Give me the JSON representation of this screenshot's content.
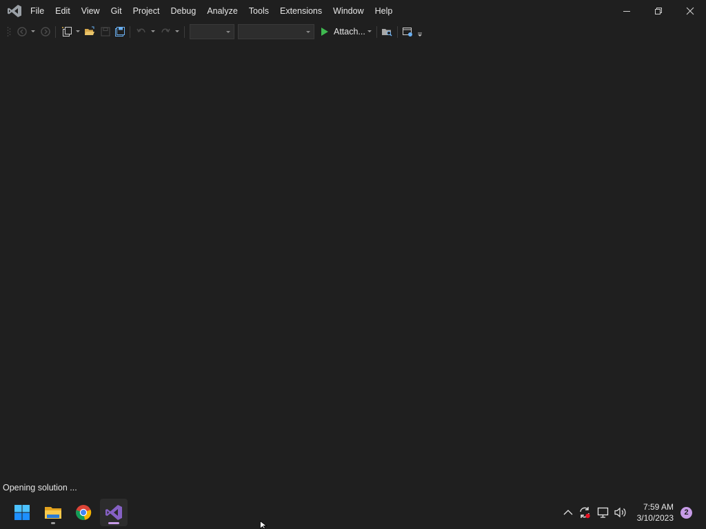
{
  "menu": {
    "items": [
      "File",
      "Edit",
      "View",
      "Git",
      "Project",
      "Debug",
      "Analyze",
      "Tools",
      "Extensions",
      "Window",
      "Help"
    ]
  },
  "window_controls": {
    "minimize_icon": "minimize-icon",
    "restore_icon": "restore-icon",
    "close_icon": "close-icon"
  },
  "toolbar": {
    "attach_label": "Attach...",
    "solution_config_value": "",
    "solution_platform_value": ""
  },
  "status": {
    "text": "Opening solution ..."
  },
  "taskbar": {
    "apps": [
      "start-icon",
      "file-explorer-icon",
      "chrome-icon",
      "visual-studio-icon"
    ],
    "clock_time": "7:59 AM",
    "clock_date": "3/10/2023",
    "notification_count": "2"
  },
  "colors": {
    "background": "#1f1f1f",
    "accent": "#c79be7",
    "run": "#3fb950"
  }
}
